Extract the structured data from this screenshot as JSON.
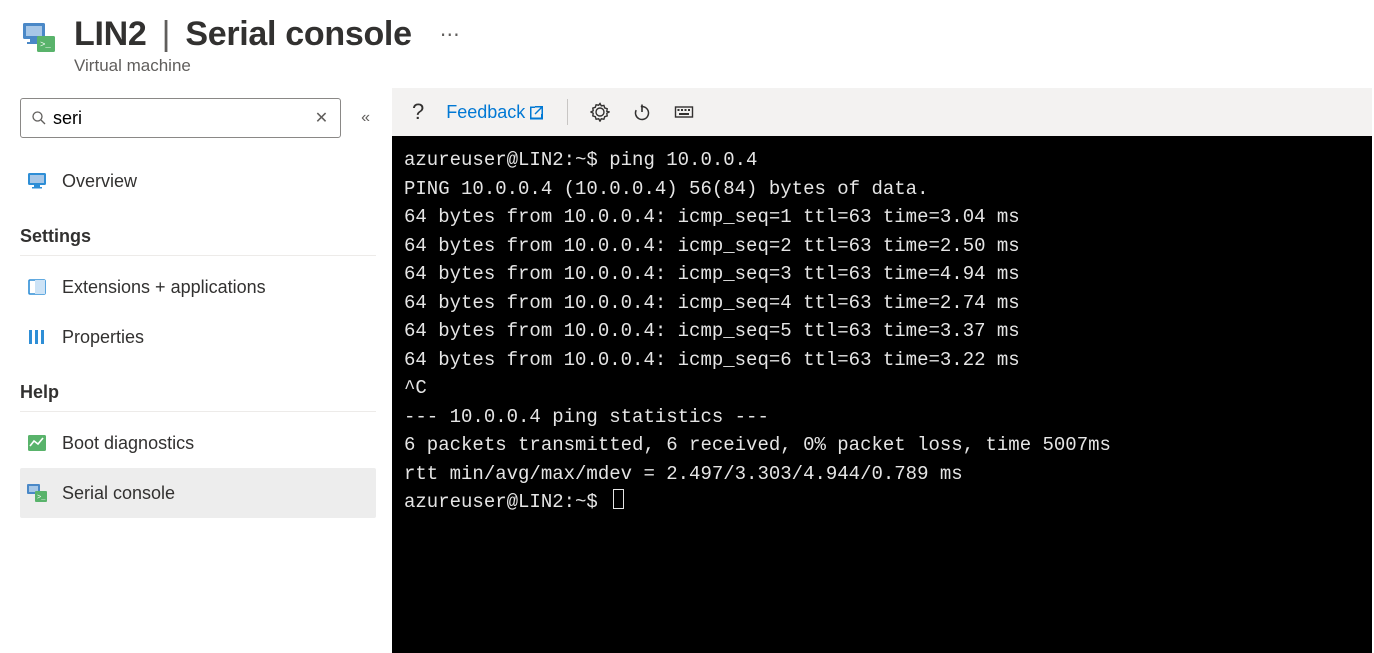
{
  "header": {
    "resource_name": "LIN2",
    "blade_name": "Serial console",
    "resource_type": "Virtual machine"
  },
  "sidebar": {
    "search_value": "seri",
    "groups": [
      {
        "heading": null,
        "items": [
          {
            "id": "overview",
            "label": "Overview",
            "icon": "monitor-icon"
          }
        ]
      },
      {
        "heading": "Settings",
        "items": [
          {
            "id": "extensions",
            "label": "Extensions + applications",
            "icon": "extension-icon"
          },
          {
            "id": "properties",
            "label": "Properties",
            "icon": "properties-icon"
          }
        ]
      },
      {
        "heading": "Help",
        "items": [
          {
            "id": "boot-diag",
            "label": "Boot diagnostics",
            "icon": "chart-icon"
          },
          {
            "id": "serial-console",
            "label": "Serial console",
            "icon": "console-icon",
            "selected": true
          }
        ]
      }
    ]
  },
  "toolbar": {
    "help_label": "?",
    "feedback_label": "Feedback"
  },
  "terminal": {
    "lines": [
      "azureuser@LIN2:~$ ping 10.0.0.4",
      "PING 10.0.0.4 (10.0.0.4) 56(84) bytes of data.",
      "64 bytes from 10.0.0.4: icmp_seq=1 ttl=63 time=3.04 ms",
      "64 bytes from 10.0.0.4: icmp_seq=2 ttl=63 time=2.50 ms",
      "64 bytes from 10.0.0.4: icmp_seq=3 ttl=63 time=4.94 ms",
      "64 bytes from 10.0.0.4: icmp_seq=4 ttl=63 time=2.74 ms",
      "64 bytes from 10.0.0.4: icmp_seq=5 ttl=63 time=3.37 ms",
      "64 bytes from 10.0.0.4: icmp_seq=6 ttl=63 time=3.22 ms",
      "^C",
      "--- 10.0.0.4 ping statistics ---",
      "6 packets transmitted, 6 received, 0% packet loss, time 5007ms",
      "rtt min/avg/max/mdev = 2.497/3.303/4.944/0.789 ms",
      "azureuser@LIN2:~$ "
    ]
  }
}
